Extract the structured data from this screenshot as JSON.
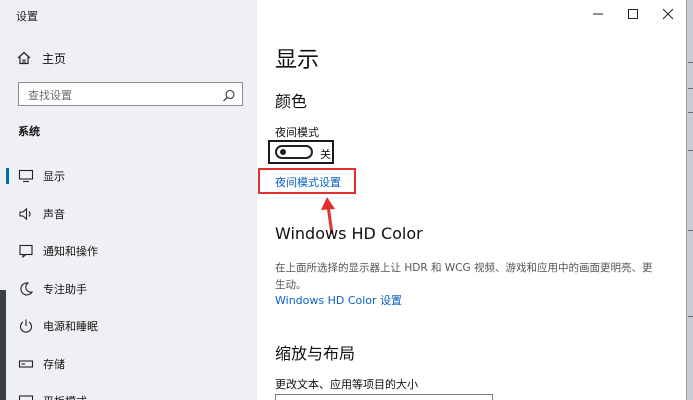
{
  "window": {
    "title": "设置"
  },
  "nav": {
    "home_label": "主页",
    "search_placeholder": "查找设置",
    "section": "系统",
    "items": [
      {
        "label": "显示",
        "icon": "monitor-icon",
        "active": true
      },
      {
        "label": "声音",
        "icon": "speaker-icon",
        "active": false
      },
      {
        "label": "通知和操作",
        "icon": "notification-icon",
        "active": false
      },
      {
        "label": "专注助手",
        "icon": "moon-icon",
        "active": false
      },
      {
        "label": "电源和睡眠",
        "icon": "power-icon",
        "active": false
      },
      {
        "label": "存储",
        "icon": "storage-icon",
        "active": false
      },
      {
        "label": "平板模式",
        "icon": "tablet-icon",
        "active": false
      }
    ]
  },
  "main": {
    "page_title": "显示",
    "color_heading": "颜色",
    "night_mode_label": "夜间模式",
    "night_mode_state": "关",
    "night_mode_on": false,
    "night_mode_settings_link": "夜间模式设置",
    "hd_heading": "Windows HD Color",
    "hd_description": "在上面所选择的显示器上让 HDR 和 WCG 视频、游戏和应用中的画面更明亮、更生动。",
    "hd_link": "Windows HD Color 设置",
    "scale_heading": "缩放与布局",
    "scale_label": "更改文本、应用等项目的大小"
  },
  "colors": {
    "accent": "#0067c0",
    "link": "#0a63c5",
    "highlight": "#e03030",
    "nav_bg": "#eef0f3"
  }
}
